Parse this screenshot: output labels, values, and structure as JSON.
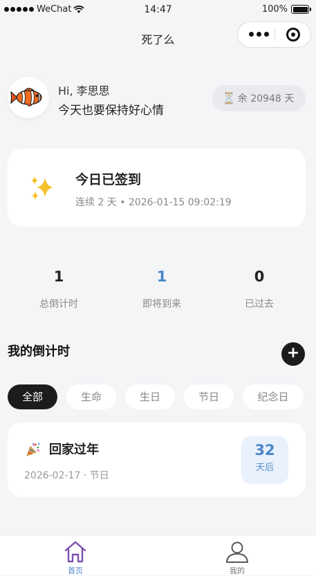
{
  "status_bar": {
    "carrier": "WeChat",
    "time": "14:47",
    "battery": "100%"
  },
  "nav": {
    "title": "死了么",
    "more_icon": "more-dots-icon",
    "close_icon": "target-circle-icon"
  },
  "profile": {
    "greeting": "Hi, 李思思",
    "motto": "今天也要保持好心情",
    "avatar_icon": "clownfish-icon",
    "remaining_icon": "hourglass-icon",
    "remaining": "余 20948 天"
  },
  "checkin": {
    "icon": "sparkles-icon",
    "title": "今日已签到",
    "subtitle": "连续 2 天 • 2026-01-15 09:02:19"
  },
  "stats": [
    {
      "value": "1",
      "label": "总倒计时",
      "color": "#222222"
    },
    {
      "value": "1",
      "label": "即将到来",
      "color": "#4a86c8"
    },
    {
      "value": "0",
      "label": "已过去",
      "color": "#222222"
    }
  ],
  "section": {
    "title": "我的倒计时",
    "add_label": "+"
  },
  "filters": [
    {
      "label": "全部",
      "active": true
    },
    {
      "label": "生命",
      "active": false
    },
    {
      "label": "生日",
      "active": false
    },
    {
      "label": "节日",
      "active": false
    },
    {
      "label": "纪念日",
      "active": false
    }
  ],
  "countdowns": [
    {
      "icon": "party-popper-icon",
      "title": "回家过年",
      "meta": "2026-02-17 · 节日",
      "days": "32",
      "days_label": "天后"
    }
  ],
  "tabbar": [
    {
      "label": "首页",
      "icon": "home-icon",
      "active": true,
      "color": "#7b4fb0"
    },
    {
      "label": "我的",
      "icon": "user-icon",
      "active": false,
      "color": "#555555"
    }
  ]
}
